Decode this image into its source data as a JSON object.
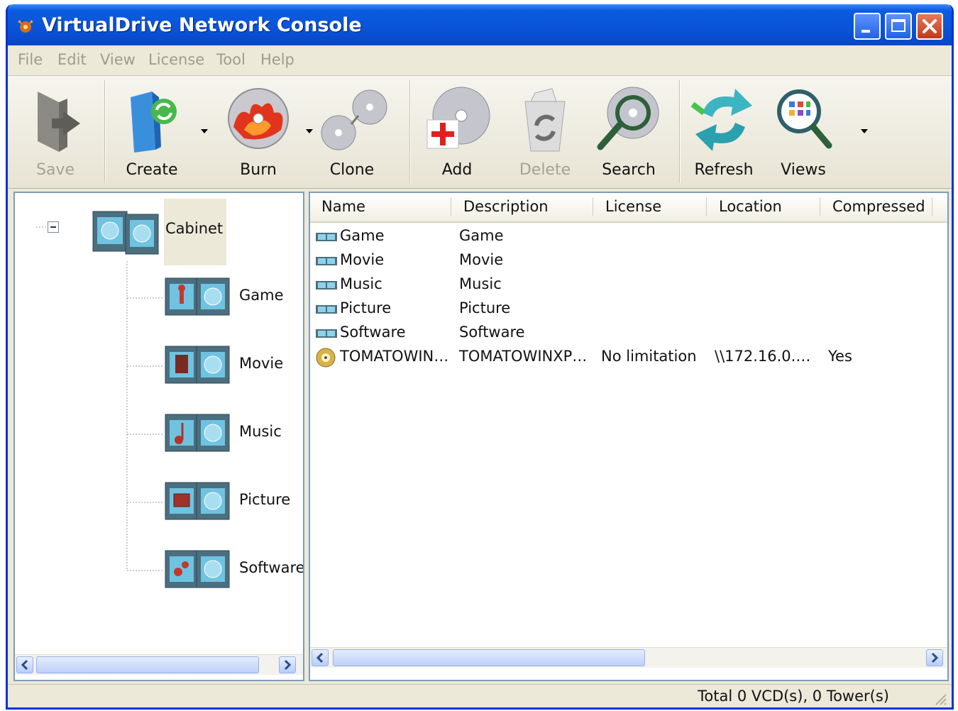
{
  "window": {
    "title": "VirtualDrive Network Console"
  },
  "menubar": {
    "items": [
      "File",
      "Edit",
      "View",
      "License",
      "Tool",
      "Help"
    ]
  },
  "toolbar": {
    "buttons": [
      {
        "label": "Save",
        "icon": "save-icon",
        "enabled": false
      },
      {
        "label": "Create",
        "icon": "create-folder-icon",
        "enabled": true
      },
      {
        "label": "Burn",
        "icon": "burn-disc-icon",
        "enabled": true
      },
      {
        "label": "Clone",
        "icon": "clone-disc-icon",
        "enabled": true
      },
      {
        "label": "Add",
        "icon": "add-disc-icon",
        "enabled": true
      },
      {
        "label": "Delete",
        "icon": "delete-recycle-icon",
        "enabled": false
      },
      {
        "label": "Search",
        "icon": "search-disc-icon",
        "enabled": true
      },
      {
        "label": "Refresh",
        "icon": "refresh-icon",
        "enabled": true
      },
      {
        "label": "Views",
        "icon": "views-magnifier-icon",
        "enabled": true
      }
    ]
  },
  "tree": {
    "root": "Cabinet",
    "children": [
      "Game",
      "Movie",
      "Music",
      "Picture",
      "Software"
    ]
  },
  "list": {
    "columns": [
      "Name",
      "Description",
      "License",
      "Location",
      "Compressed"
    ],
    "rows": [
      {
        "name": "Game",
        "description": "Game",
        "license": "",
        "location": "",
        "compressed": "",
        "icon": "tower-icon"
      },
      {
        "name": "Movie",
        "description": "Movie",
        "license": "",
        "location": "",
        "compressed": "",
        "icon": "tower-icon"
      },
      {
        "name": "Music",
        "description": "Music",
        "license": "",
        "location": "",
        "compressed": "",
        "icon": "tower-icon"
      },
      {
        "name": "Picture",
        "description": "Picture",
        "license": "",
        "location": "",
        "compressed": "",
        "icon": "tower-icon"
      },
      {
        "name": "Software",
        "description": "Software",
        "license": "",
        "location": "",
        "compressed": "",
        "icon": "tower-icon"
      },
      {
        "name": "TOMATOWIN…",
        "description": "TOMATOWINXP…",
        "license": "No limitation",
        "location": "\\\\172.16.0.…",
        "compressed": "Yes",
        "icon": "vcd-disc-icon"
      }
    ]
  },
  "statusbar": {
    "text": "Total 0 VCD(s), 0 Tower(s)"
  },
  "colors": {
    "titlebar": "#0a53d6",
    "border": "#0831d9",
    "face": "#ece9d8"
  }
}
